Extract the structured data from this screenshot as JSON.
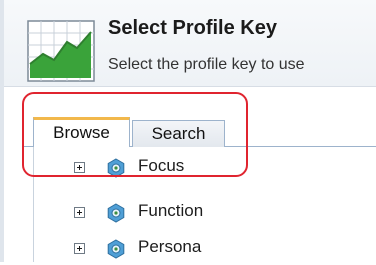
{
  "dialog": {
    "title": "Select Profile Key",
    "subtitle": "Select the profile key to use"
  },
  "tabs": [
    {
      "label": "Browse",
      "selected": true
    },
    {
      "label": "Search",
      "selected": false
    }
  ],
  "tree": {
    "nodes": [
      {
        "label": "Focus",
        "icon": "gear-node-icon"
      },
      {
        "label": "Function",
        "icon": "gear-node-icon"
      },
      {
        "label": "Persona",
        "icon": "gear-node-icon"
      }
    ]
  },
  "colors": {
    "highlight": "#e0242f",
    "tab_accent": "#f2b84b",
    "tab_border": "#9db3cc"
  }
}
